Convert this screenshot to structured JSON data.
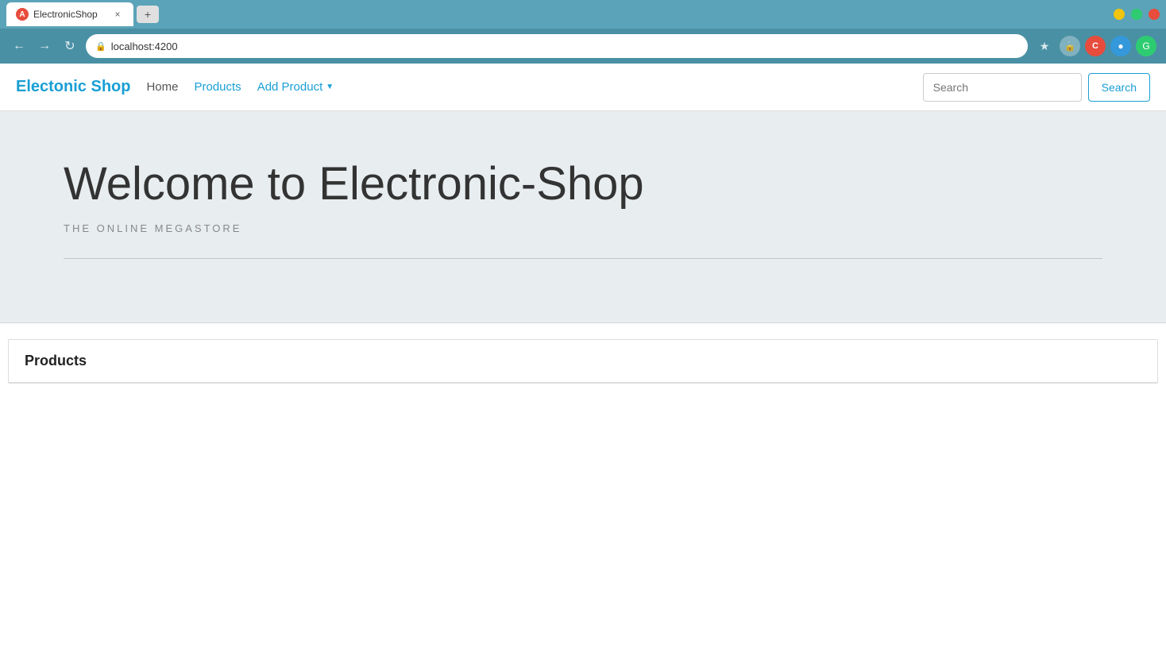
{
  "browser": {
    "tab": {
      "title": "ElectronicShop",
      "icon": "A",
      "close": "×"
    },
    "url": "localhost:4200",
    "new_tab_icon": "+"
  },
  "navbar": {
    "brand": "Electonic Shop",
    "links": [
      {
        "label": "Home",
        "active": false
      },
      {
        "label": "Products",
        "active": true
      },
      {
        "label": "Add Product",
        "dropdown": true
      }
    ],
    "search_placeholder": "Search",
    "search_button_label": "Search"
  },
  "hero": {
    "title": "Welcome to Electronic-Shop",
    "subtitle": "THE ONLINE MEGASTORE"
  },
  "products": {
    "section_title": "Products"
  }
}
